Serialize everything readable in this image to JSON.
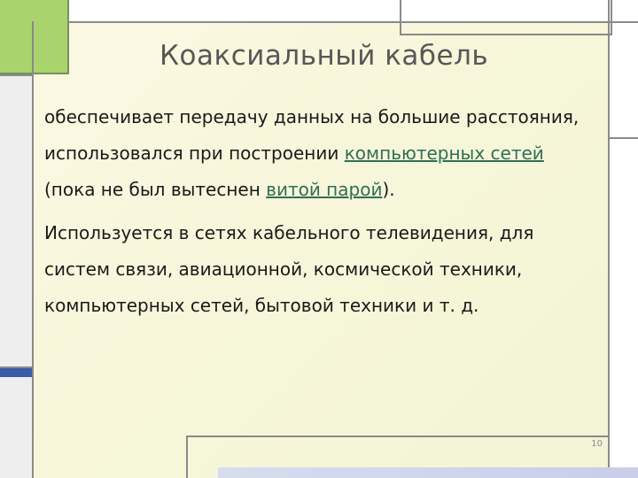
{
  "slide": {
    "title": "Коаксиальный кабель",
    "paragraph1": {
      "text_1": "обеспечивает передачу данных на большие расстояния, использовался при построении ",
      "link_1": "компьютерных сетей",
      "text_2": " (пока не был вытеснен ",
      "link_2": "витой парой",
      "text_3": ")."
    },
    "paragraph2": "Используется в сетях кабельного телевидения, для систем связи, авиационной, космической техники, компьютерных сетей, бытовой техники и т. д.",
    "slide_number": "10"
  },
  "colors": {
    "accent_green": "#a9d46d",
    "link": "#2f6f55",
    "accent_blue": "#3b5aa8"
  }
}
